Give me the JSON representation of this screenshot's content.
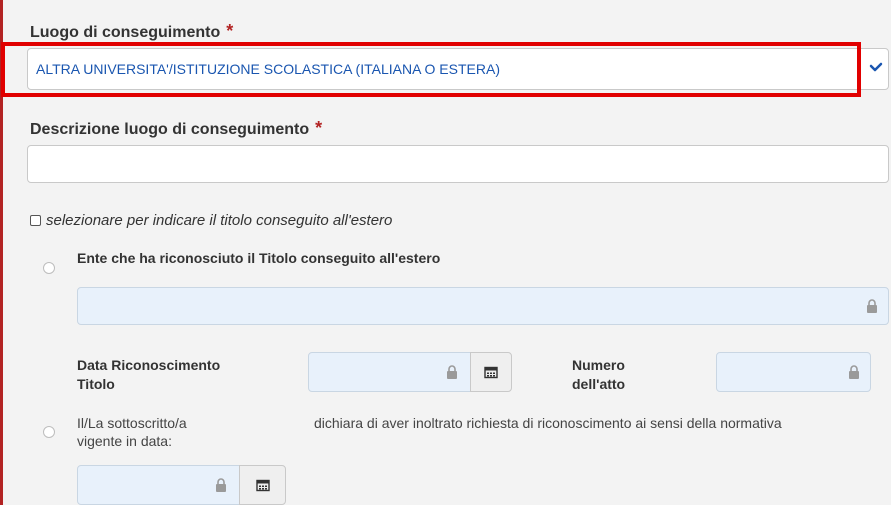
{
  "form": {
    "luogo_label": "Luogo di conseguimento",
    "required_mark": "*",
    "luogo_value": "ALTRA UNIVERSITA'/ISTITUZIONE SCOLASTICA (ITALIANA O ESTERA)",
    "descrizione_label": "Descrizione luogo di conseguimento",
    "descrizione_value": "",
    "estero_checkbox_label": "selezionare per indicare il titolo conseguito all'estero",
    "ente_label": "Ente che ha riconosciuto il Titolo conseguito all'estero",
    "data_riconoscimento_label_line1": "Data Riconoscimento",
    "data_riconoscimento_label_line2": "Titolo",
    "numero_atto_label_line1": "Numero",
    "numero_atto_label_line2": "dell'atto",
    "dichiara_prefix": "Il/La sottoscritto/a",
    "dichiara_text": "dichiara di aver inoltrato richiesta di riconoscimento ai sensi della normativa",
    "dichiara_line2": "vigente in data:"
  },
  "colors": {
    "accent_blue": "#1a56b0",
    "required_red": "#b22222",
    "highlight_red": "#e10000",
    "locked_bg": "#e8f1fb"
  },
  "icons": {
    "select_chevron": "chevron-down-icon",
    "lock": "lock-icon",
    "calendar": "calendar-icon"
  }
}
